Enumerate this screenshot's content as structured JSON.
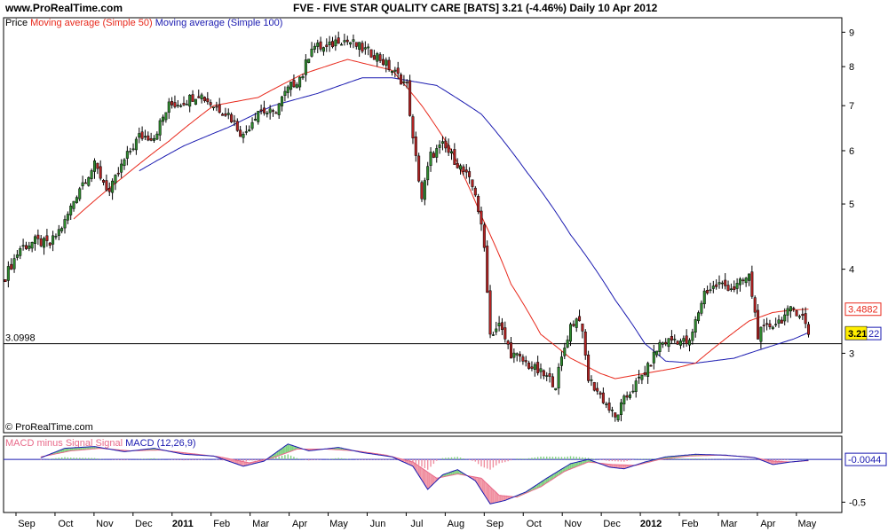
{
  "header": {
    "site": "www.ProRealTime.com",
    "title": "FVE - FIVE STAR QUALITY CARE [BATS]    3.21 (-4.46%)    Daily  10 Apr 2012"
  },
  "legend": {
    "price_label": "Price",
    "ma50_label": "Moving average (Simple 50)",
    "ma100_label": "Moving average (Simple 100)"
  },
  "copyright": "© ProRealTime.com",
  "macd_legend": {
    "hist_label": "MACD minus Signal Signal",
    "macd_label": "MACD (12,26,9)"
  },
  "colors": {
    "ma50": "#e8291c",
    "ma100": "#1a1ab0",
    "candle_up": "#2e8b2e",
    "candle_down": "#b22222",
    "hist_pos": "#7fd17f",
    "hist_neg": "#f08fa0",
    "signal": "#e86a8a",
    "price_badge": "#ffee00"
  },
  "chart_data": [
    {
      "type": "candlestick",
      "y_scale": "log",
      "ylim": [
        2.3,
        9.4
      ],
      "yticks": [
        3,
        4,
        5,
        6,
        7,
        8,
        9
      ],
      "months": [
        "Sep",
        "Oct",
        "Nov",
        "Dec",
        "2011",
        "Feb",
        "Mar",
        "Apr",
        "May",
        "Jun",
        "Jul",
        "Aug",
        "Sep",
        "Oct",
        "Nov",
        "Dec",
        "2012",
        "Feb",
        "Mar",
        "Apr",
        "May"
      ],
      "bold_months": [
        "2011",
        "2012"
      ],
      "reference_line": {
        "value": 3.0998,
        "label": "3.0998"
      },
      "last_price": {
        "value": 3.21,
        "label": "3.21"
      },
      "ma50_last": {
        "value": 3.4882,
        "label": "3.4882"
      },
      "ma100_last_label": "22",
      "close_path": [
        [
          0,
          3.9
        ],
        [
          5,
          4.3
        ],
        [
          10,
          4.4
        ],
        [
          15,
          4.35
        ],
        [
          20,
          4.7
        ],
        [
          25,
          5.3
        ],
        [
          30,
          5.7
        ],
        [
          35,
          5.2
        ],
        [
          40,
          5.8
        ],
        [
          45,
          6.3
        ],
        [
          50,
          6.3
        ],
        [
          55,
          7.0
        ],
        [
          60,
          7.1
        ],
        [
          65,
          7.3
        ],
        [
          70,
          7.0
        ],
        [
          75,
          6.8
        ],
        [
          80,
          6.3
        ],
        [
          85,
          6.9
        ],
        [
          90,
          6.8
        ],
        [
          95,
          7.4
        ],
        [
          100,
          7.8
        ],
        [
          103,
          8.6
        ],
        [
          108,
          8.5
        ],
        [
          112,
          8.8
        ],
        [
          116,
          8.7
        ],
        [
          120,
          8.5
        ],
        [
          125,
          8.3
        ],
        [
          130,
          7.9
        ],
        [
          135,
          7.5
        ],
        [
          137,
          6.2
        ],
        [
          140,
          5.1
        ],
        [
          143,
          5.9
        ],
        [
          147,
          6.1
        ],
        [
          150,
          5.9
        ],
        [
          155,
          5.5
        ],
        [
          158,
          5.2
        ],
        [
          161,
          4.3
        ],
        [
          163,
          3.2
        ],
        [
          166,
          3.3
        ],
        [
          170,
          3.0
        ],
        [
          175,
          2.9
        ],
        [
          180,
          2.8
        ],
        [
          185,
          2.7
        ],
        [
          190,
          3.3
        ],
        [
          193,
          3.4
        ],
        [
          196,
          2.75
        ],
        [
          200,
          2.6
        ],
        [
          205,
          2.4
        ],
        [
          208,
          2.55
        ],
        [
          212,
          2.7
        ],
        [
          216,
          2.85
        ],
        [
          220,
          3.1
        ],
        [
          225,
          3.15
        ],
        [
          230,
          3.1
        ],
        [
          235,
          3.7
        ],
        [
          240,
          3.8
        ],
        [
          245,
          3.75
        ],
        [
          250,
          3.9
        ],
        [
          253,
          3.2
        ],
        [
          257,
          3.3
        ],
        [
          260,
          3.35
        ],
        [
          265,
          3.5
        ],
        [
          268,
          3.4
        ],
        [
          270,
          3.21
        ]
      ],
      "ma50_path": [
        [
          23,
          4.75
        ],
        [
          40,
          5.5
        ],
        [
          55,
          6.2
        ],
        [
          70,
          7.0
        ],
        [
          85,
          7.2
        ],
        [
          100,
          7.8
        ],
        [
          115,
          8.2
        ],
        [
          130,
          7.9
        ],
        [
          140,
          7.0
        ],
        [
          150,
          6.0
        ],
        [
          160,
          4.8
        ],
        [
          170,
          3.8
        ],
        [
          180,
          3.2
        ],
        [
          190,
          2.95
        ],
        [
          200,
          2.8
        ],
        [
          205,
          2.75
        ],
        [
          215,
          2.8
        ],
        [
          225,
          2.85
        ],
        [
          232,
          2.9
        ],
        [
          240,
          3.1
        ],
        [
          250,
          3.35
        ],
        [
          258,
          3.45
        ],
        [
          265,
          3.48
        ],
        [
          270,
          3.4882
        ]
      ],
      "ma100_path": [
        [
          45,
          5.6
        ],
        [
          60,
          6.1
        ],
        [
          75,
          6.5
        ],
        [
          90,
          7.0
        ],
        [
          105,
          7.3
        ],
        [
          120,
          7.7
        ],
        [
          130,
          7.7
        ],
        [
          145,
          7.5
        ],
        [
          160,
          6.8
        ],
        [
          175,
          5.6
        ],
        [
          190,
          4.5
        ],
        [
          205,
          3.6
        ],
        [
          215,
          3.1
        ],
        [
          222,
          2.92
        ],
        [
          232,
          2.9
        ],
        [
          245,
          2.95
        ],
        [
          255,
          3.05
        ],
        [
          265,
          3.15
        ],
        [
          270,
          3.22
        ]
      ]
    },
    {
      "type": "macd",
      "ylim": [
        -0.6,
        0.25
      ],
      "yticks": [
        -0.5
      ],
      "zero_label": "-0.0044",
      "macd_path": [
        [
          12,
          0.02
        ],
        [
          20,
          0.13
        ],
        [
          30,
          0.15
        ],
        [
          40,
          0.09
        ],
        [
          50,
          0.13
        ],
        [
          60,
          0.06
        ],
        [
          70,
          0.04
        ],
        [
          80,
          -0.08
        ],
        [
          87,
          -0.02
        ],
        [
          95,
          0.18
        ],
        [
          102,
          0.1
        ],
        [
          112,
          0.14
        ],
        [
          120,
          0.08
        ],
        [
          130,
          0.03
        ],
        [
          137,
          -0.08
        ],
        [
          142,
          -0.35
        ],
        [
          147,
          -0.18
        ],
        [
          152,
          -0.12
        ],
        [
          158,
          -0.25
        ],
        [
          163,
          -0.52
        ],
        [
          168,
          -0.48
        ],
        [
          175,
          -0.38
        ],
        [
          182,
          -0.22
        ],
        [
          190,
          -0.05
        ],
        [
          196,
          0.0
        ],
        [
          203,
          -0.09
        ],
        [
          208,
          -0.11
        ],
        [
          215,
          -0.03
        ],
        [
          222,
          0.03
        ],
        [
          232,
          0.06
        ],
        [
          242,
          0.05
        ],
        [
          252,
          0.02
        ],
        [
          258,
          -0.06
        ],
        [
          264,
          -0.03
        ],
        [
          270,
          -0.01
        ]
      ],
      "signal_path": [
        [
          12,
          0.03
        ],
        [
          22,
          0.1
        ],
        [
          32,
          0.13
        ],
        [
          42,
          0.1
        ],
        [
          52,
          0.11
        ],
        [
          62,
          0.07
        ],
        [
          72,
          0.03
        ],
        [
          82,
          -0.04
        ],
        [
          90,
          0.02
        ],
        [
          98,
          0.12
        ],
        [
          108,
          0.12
        ],
        [
          118,
          0.1
        ],
        [
          128,
          0.05
        ],
        [
          137,
          -0.03
        ],
        [
          145,
          -0.22
        ],
        [
          152,
          -0.17
        ],
        [
          160,
          -0.22
        ],
        [
          166,
          -0.42
        ],
        [
          172,
          -0.44
        ],
        [
          180,
          -0.32
        ],
        [
          188,
          -0.14
        ],
        [
          196,
          -0.03
        ],
        [
          204,
          -0.06
        ],
        [
          212,
          -0.07
        ],
        [
          220,
          0.0
        ],
        [
          230,
          0.04
        ],
        [
          240,
          0.05
        ],
        [
          250,
          0.03
        ],
        [
          258,
          -0.02
        ],
        [
          264,
          -0.03
        ],
        [
          270,
          -0.015
        ]
      ]
    }
  ]
}
